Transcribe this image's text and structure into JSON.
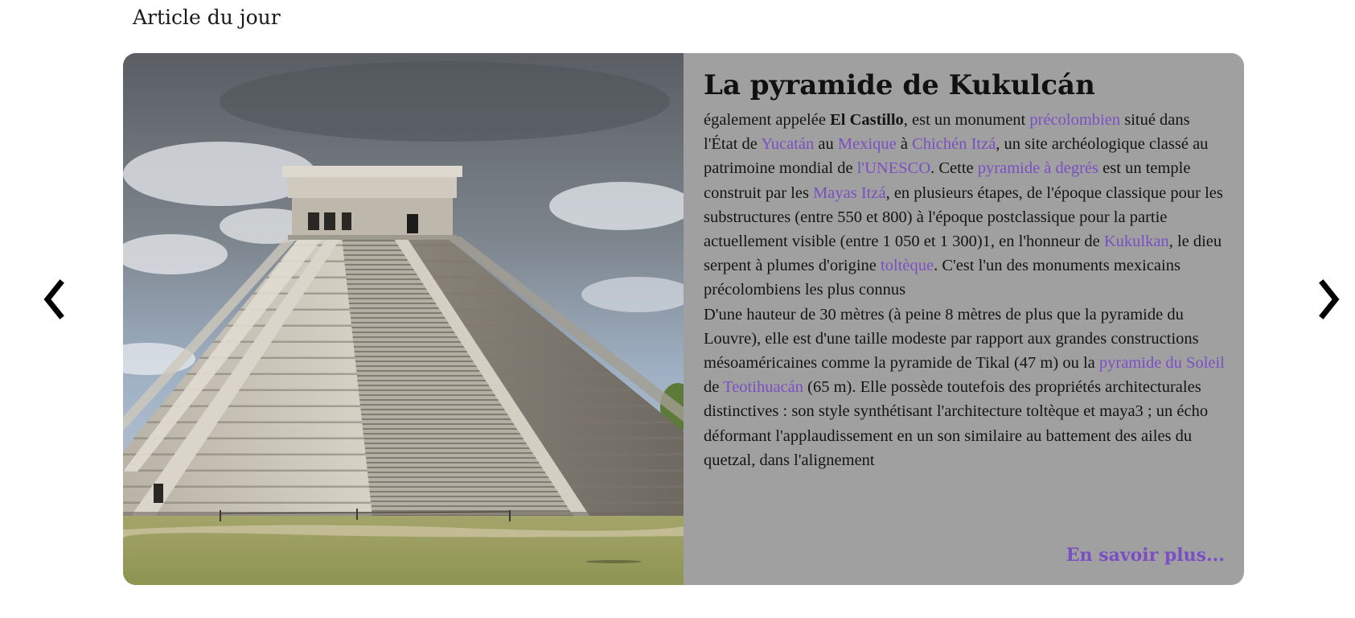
{
  "section": {
    "title": "Article du jour"
  },
  "carousel": {
    "prev_icon": "chevron-left-icon",
    "next_icon": "chevron-right-icon"
  },
  "article": {
    "image_alt": "Pyramide de Kukulcán à Chichén Itzá",
    "title": "La pyramide de Kukulcán",
    "p1": {
      "t0": "également appelée ",
      "bold": "El Castillo",
      "t1": ", est un monument ",
      "l0": "précolombien",
      "t2": " situé dans l'État de ",
      "l1": "Yucatán",
      "t3": " au ",
      "l2": "Mexique",
      "t4": " à ",
      "l3": "Chichén Itzá",
      "t5": ", un site archéologique classé au patrimoine mondial de ",
      "l4": "l'UNESCO",
      "t6": ". Cette ",
      "l5": "pyramide à degrés",
      "t7": " est un temple construit par les ",
      "l6": "Mayas Itzá",
      "t8": ", en plusieurs étapes, de l'époque classique pour les substructures (entre 550 et 800) à l'époque postclassique pour la partie actuellement visible (entre 1 050 et 1 300)1, en l'honneur de ",
      "l7": "Kukulkan",
      "t9": ", le dieu serpent à plumes d'origine ",
      "l8": "toltèque",
      "t10": ". C'est l'un des monuments mexicains précolombiens les plus connus"
    },
    "p2": {
      "t0": "D'une hauteur de 30 mètres (à peine 8 mètres de plus que la pyramide du Louvre), elle est d'une taille modeste par rapport aux grandes constructions mésoaméricaines comme la pyramide de Tikal (47 m) ou la ",
      "l0": "pyramide du Soleil",
      "t1": " de ",
      "l1": "Teotihuacán",
      "t2": " (65 m). Elle possède toutefois des propriétés architecturales distinctives : son style synthétisant l'architecture toltèque et maya3 ; un écho déformant l'applaudissement en un son similaire au battement des ailes du quetzal, dans l'alignement"
    },
    "more_label": "En savoir plus...",
    "link_color": "#7b4fc4",
    "panel_color": "#a0a0a0"
  }
}
